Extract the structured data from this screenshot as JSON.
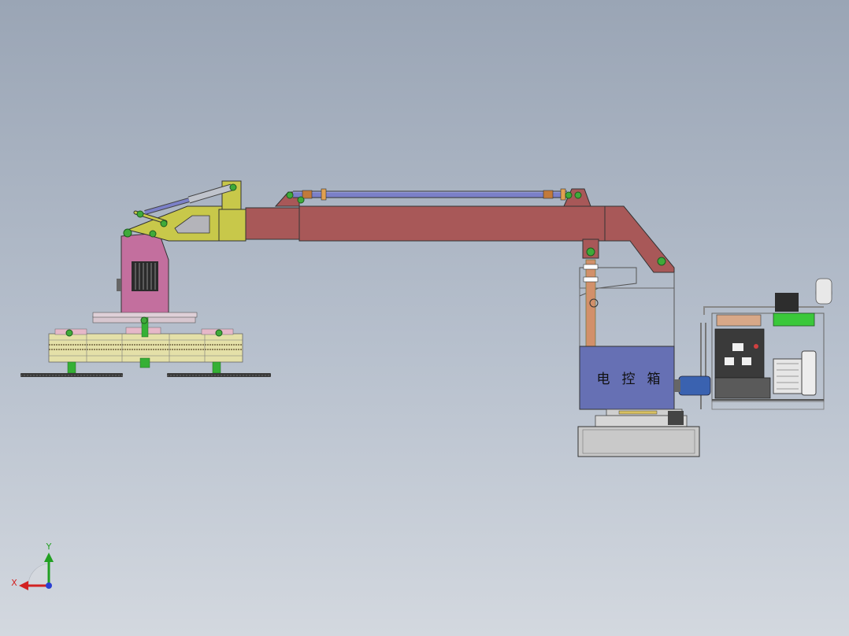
{
  "panel": {
    "label_chars": [
      "电",
      "控",
      "箱"
    ]
  },
  "triad": {
    "x_label": "X",
    "y_label": "Y"
  },
  "colors": {
    "background_top": "#9aa5b5",
    "background_bottom": "#d3d8df",
    "boom_body": "#a85858",
    "head_frame": "#c8c84a",
    "motor_housing": "#c36f9e",
    "control_box": "#6670b4",
    "cylinder": "#7b80c8",
    "pin_joint": "#3faa3a",
    "axis_x": "#d22222",
    "axis_y": "#22a022",
    "axis_z": "#2a3fd2"
  }
}
